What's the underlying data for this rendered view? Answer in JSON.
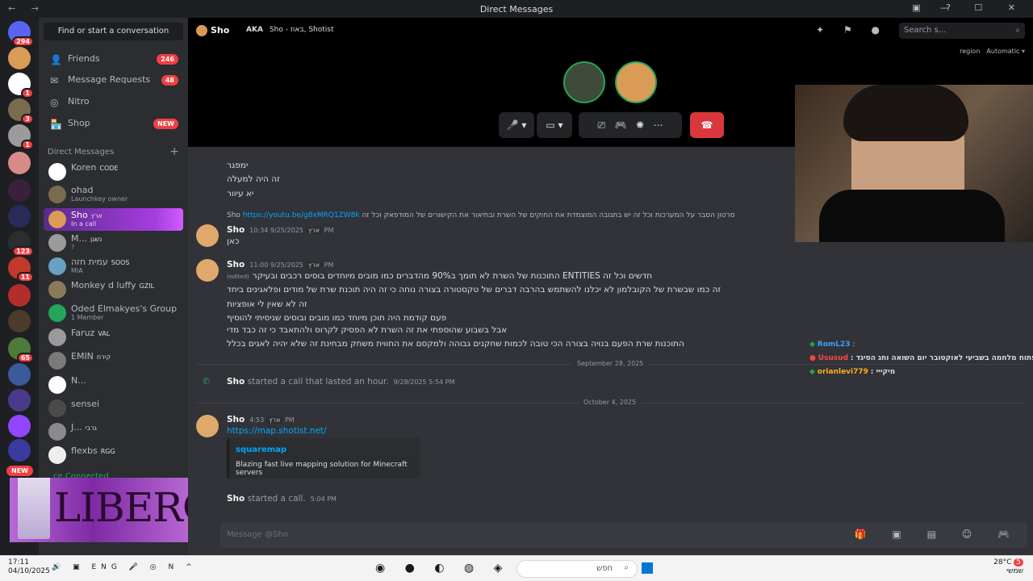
{
  "window": {
    "title": "Direct Messages"
  },
  "guilds": {
    "home_badge": "294",
    "new_label": "NEW",
    "badges": [
      "1",
      "3",
      "1",
      "123",
      "11",
      "65"
    ]
  },
  "sidebar": {
    "find_label": "Find or start a conversation",
    "nav": [
      {
        "label": "Friends",
        "badge": "246",
        "icon": "friends-icon"
      },
      {
        "label": "Message Requests",
        "badge": "48",
        "icon": "mail-icon"
      },
      {
        "label": "Nitro",
        "badge": "",
        "icon": "nitro-icon"
      },
      {
        "label": "Shop",
        "badge": "NEW",
        "icon": "shop-icon"
      }
    ],
    "dm_header": "Direct Messages",
    "dms": [
      {
        "name": "Koren",
        "tag": "CODE",
        "sub": ""
      },
      {
        "name": "ohad",
        "tag": "",
        "sub": "Launchkey owner"
      },
      {
        "name": "Sho",
        "tag": "ארץ",
        "sub": "In a call"
      },
      {
        "name": "M...",
        "tag": "נשגן",
        "sub": "?"
      },
      {
        "name": "עמית חזה",
        "tag": "SOOS",
        "sub": "MIA"
      },
      {
        "name": "Monkey d luffy",
        "tag": "GZIL",
        "sub": ""
      },
      {
        "name": "Oded Elmakyes's Group",
        "tag": "",
        "sub": "1 Member"
      },
      {
        "name": "Faruz",
        "tag": "VAL",
        "sub": ""
      },
      {
        "name": "EMIN",
        "tag": "קירח",
        "sub": ""
      },
      {
        "name": "N...",
        "tag": "",
        "sub": ""
      },
      {
        "name": "sensei",
        "tag": "",
        "sub": ""
      },
      {
        "name": "J...",
        "tag": "גרבי",
        "sub": ""
      },
      {
        "name": "flexbs",
        "tag": "RGG",
        "sub": ""
      }
    ],
    "voice_status": "ce Connected",
    "ad_text": "LIBERO"
  },
  "header": {
    "name": "Sho",
    "aka_label": "AKA",
    "aka": "Sho - באוז, Shotist",
    "search_placeholder": "Search s...",
    "region_label": "region",
    "region_value": "Automatic"
  },
  "messages": {
    "lines_top": [
      "ימפגר",
      "זה היה למעלה",
      "יא עיוור"
    ],
    "reply_ref": {
      "author": "Sho",
      "link": "https://youtu.be/g8xMRQ1ZW8k",
      "text": "סרטון הסבר על המערכות וכל זה יש בתגובה המוצמדת את החוקים של השרת ובתיאור את הקישורים של המודפאק וכל זה"
    },
    "m1": {
      "author": "Sho",
      "tag": "ארץ",
      "time": "9/25/2025 10:34 PM",
      "text": "כאן"
    },
    "m2": {
      "author": "Sho",
      "tag": "ארץ",
      "time": "9/25/2025 11:00 PM",
      "edited": "(edited)",
      "lines": [
        "התוכנות של השרת לא תומך ב90% מהדברים כמו מובים מיוחדים בוסים רכבים ובעיקר ENTITIES חדשים וכל זה",
        "זה כמו שבשרת של הקובלמון לא יכלנו להשתמש בהרבה דברים של טקסטורה בצורה נוחה כי זה היה תוכנת שרת של מודים ופלאגינים ביחד",
        "זה לא שאין לי אופציות",
        "פעם קודמת היה תוכן מיוחד כמו מובים ובוסים שניסיתי להוסיף",
        "אבל בשבוע שהוספתי את זה השרת לא הפסיק לקרוס ולהתאבד כי זה כבד מדי",
        "התוכנות שרת הפעם בנויה בצורה הכי טובה לכמות שחקנים גבוהה ולמקסם את החווית משחק מבחינת זה שלא יהיה לאגים בכלל"
      ]
    },
    "call1": {
      "author": "Sho",
      "text": "started a call that lasted an hour.",
      "time": "9/28/2025 5:54 PM"
    },
    "sep1": "September 28, 2025",
    "sep2": "October 4, 2025",
    "m3": {
      "author": "Sho",
      "tag": "ארץ",
      "time": "4:53 PM",
      "link": "https://map.shotist.net/"
    },
    "embed": {
      "title": "squaremap",
      "desc": "Blazing fast live mapping solution for Minecraft servers"
    },
    "call2": {
      "author": "Sho",
      "text": "started a call.",
      "time": "5:04 PM"
    },
    "composer_placeholder": "Message @Sho"
  },
  "chat_overlay": [
    {
      "user": "RomL23",
      "text": ":",
      "color": "#3ba0ff"
    },
    {
      "user": "Ususud",
      "text": ": רשבר לפתוח מלחמה בשביעי לאוקטובר יום השואה וחג הסיגד",
      "color": "#ff4646"
    },
    {
      "user": "orianlevi779",
      "text": ": מיקייי",
      "color": "#ffb020"
    }
  ],
  "taskbar": {
    "time": "17:11",
    "date": "04/10/2025",
    "lang": "ENG",
    "search": "חפש",
    "temp": "28°C",
    "weather": "שמשי",
    "notif": "5"
  }
}
